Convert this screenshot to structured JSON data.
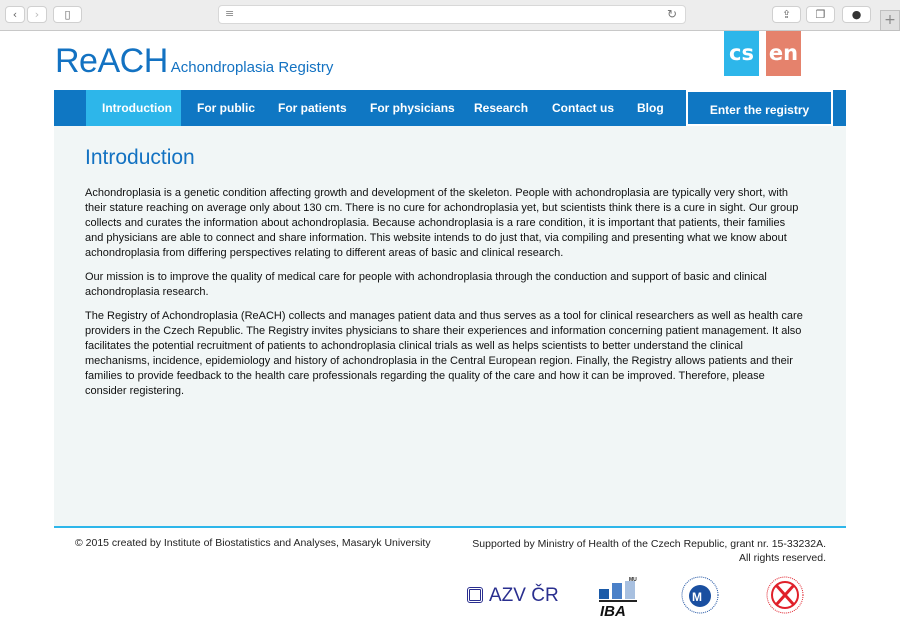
{
  "browser": {
    "back_icon": "chevron-left-icon",
    "forward_icon": "chevron-right-icon",
    "sidebar_icon": "sidebar-icon",
    "reader_icon": "reader-icon",
    "reload_icon": "reload-icon",
    "share_icon": "share-icon",
    "tabs_icon": "tabs-icon",
    "download_icon": "download-icon",
    "new_tab": "+"
  },
  "header": {
    "logo": "ReACH",
    "subtitle": "Achondroplasia Registry",
    "lang_cs": "cs",
    "lang_en": "en",
    "colors": {
      "brand": "#1372c2",
      "cs": "#2db6ea",
      "en": "#e5826c"
    }
  },
  "nav": {
    "items": [
      "Introduction",
      "For public",
      "For patients",
      "For physicians",
      "Research",
      "Contact us",
      "Blog"
    ],
    "active": "Introduction",
    "enter": "Enter the registry"
  },
  "main": {
    "title": "Introduction",
    "paragraphs": [
      "Achondroplasia is a genetic condition affecting growth and development of the skeleton. People with achondroplasia are typically very short, with their stature reaching on average only about 130 cm. There is no cure for achondroplasia yet, but scientists think there is a cure in sight. Our group collects and curates the information about achondroplasia. Because achondroplasia is a rare condition, it is important that patients, their families and physicians are able to connect and share information. This website intends to do just that, via compiling and presenting what we know about achondroplasia from differing perspectives relating to different areas of basic and clinical research.",
      "Our mission is to improve the quality of medical care for people with achondroplasia through the conduction and support of basic and clinical achondroplasia research.",
      "The Registry of Achondroplasia (ReACH) collects and manages patient data and thus serves as a tool for clinical researchers as well as health care providers in the Czech Republic. The Registry invites physicians to share their experiences and information concerning patient management. It also facilitates the potential recruitment of patients to achondroplasia clinical trials as well as helps scientists to better understand the clinical mechanisms, incidence, epidemiology and history of achondroplasia in the Central European region. Finally, the Registry allows patients and their families to provide feedback to the health care professionals regarding the quality of the care and how it can be improved. Therefore, please consider registering."
    ]
  },
  "footer": {
    "left": "© 2015 created by Institute of Biostatistics and Analyses, Masaryk University",
    "right1": "Supported by Ministry of Health of the Czech Republic, grant nr. 15-33232A.",
    "right2": "All rights reserved.",
    "logos": {
      "azv": "AZV ČR",
      "iba": "IBA",
      "mu": "MU"
    }
  }
}
